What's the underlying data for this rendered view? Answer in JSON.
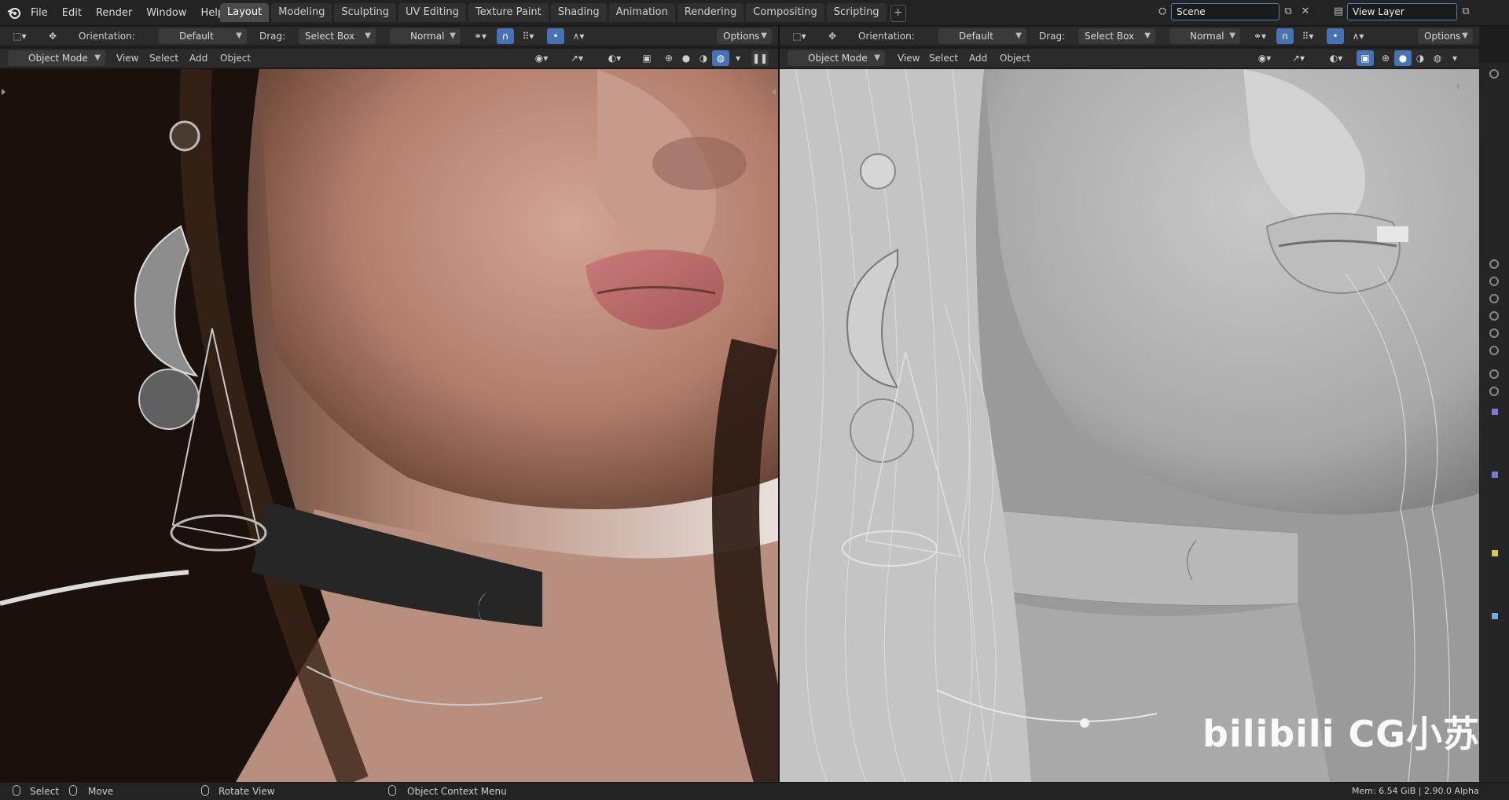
{
  "menu": [
    "File",
    "Edit",
    "Render",
    "Window",
    "Help"
  ],
  "workspace_tabs": [
    "Layout",
    "Modeling",
    "Sculpting",
    "UV Editing",
    "Texture Paint",
    "Shading",
    "Animation",
    "Rendering",
    "Compositing",
    "Scripting"
  ],
  "workspace_add": "+",
  "scene": {
    "value": "Scene",
    "close": "✕"
  },
  "view_layer": {
    "value": "View Layer"
  },
  "left_view": {
    "orientation_label": "Orientation:",
    "orientation_value": "Default",
    "drag_label": "Drag:",
    "drag_value": "Select Box",
    "pivot_value": "Normal",
    "options_label": "Options",
    "mode_value": "Object Mode",
    "view_menu": [
      "View",
      "Select",
      "Add",
      "Object"
    ],
    "shading": "rendered"
  },
  "right_view": {
    "orientation_label": "Orientation:",
    "orientation_value": "Default",
    "drag_label": "Drag:",
    "drag_value": "Select Box",
    "pivot_value": "Normal",
    "options_label": "Options",
    "mode_value": "Object Mode",
    "view_menu": [
      "View",
      "Select",
      "Add",
      "Object"
    ],
    "shading": "solid"
  },
  "status": {
    "select": "Select",
    "move": "Move",
    "rotate_view": "Rotate View",
    "context_menu": "Object Context Menu",
    "mem": "Mem: 6.54 GiB | 2.90.0 Alpha"
  },
  "watermark": "bilibili CG小苏",
  "colors": {
    "accent": "#4772b3",
    "header": "#2b2b2b",
    "topbar": "#232323"
  }
}
